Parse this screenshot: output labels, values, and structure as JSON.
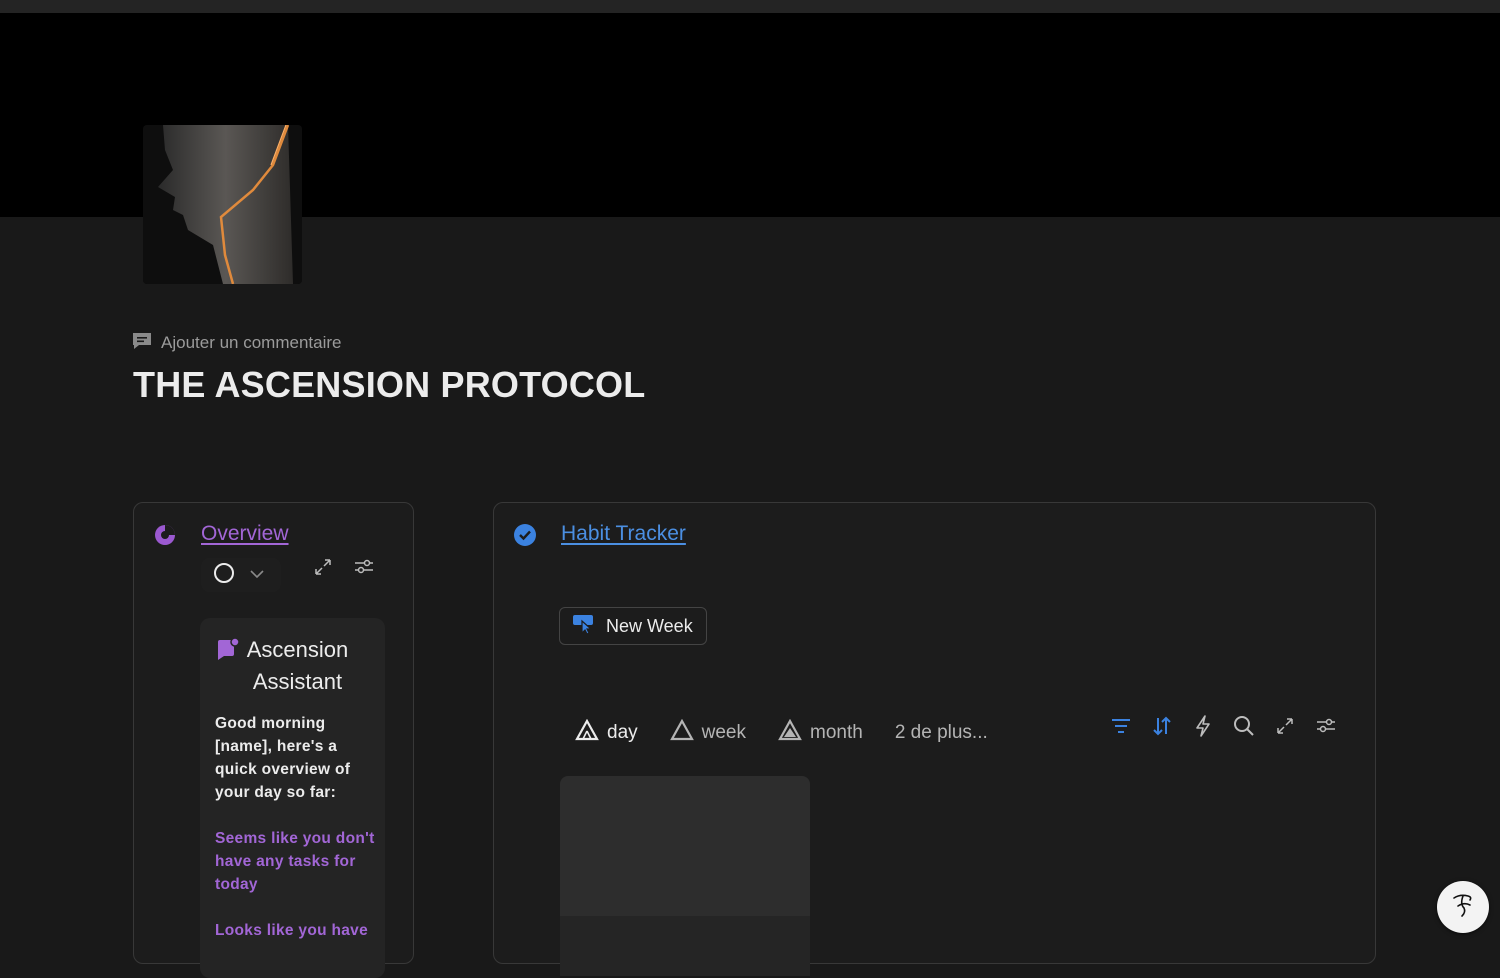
{
  "page": {
    "comment_label": "Ajouter un commentaire",
    "title": "THE ASCENSION PROTOCOL"
  },
  "overview": {
    "title": "Overview",
    "accent_color": "#9b59d0",
    "assistant": {
      "title": "Ascension Assistant",
      "greeting": "Good morning [name], here's a quick overview of your day so far:",
      "tasks_message": "Seems like you don't have any tasks for today",
      "next_message": "Looks like you have"
    }
  },
  "habit_tracker": {
    "title": "Habit Tracker",
    "accent_color": "#3b82e0",
    "new_week_label": "New Week",
    "tabs": [
      {
        "label": "day",
        "active": true
      },
      {
        "label": "week",
        "active": false
      },
      {
        "label": "month",
        "active": false
      }
    ],
    "more_views_label": "2 de plus..."
  },
  "help": {
    "icon": "help-glyph-icon"
  }
}
